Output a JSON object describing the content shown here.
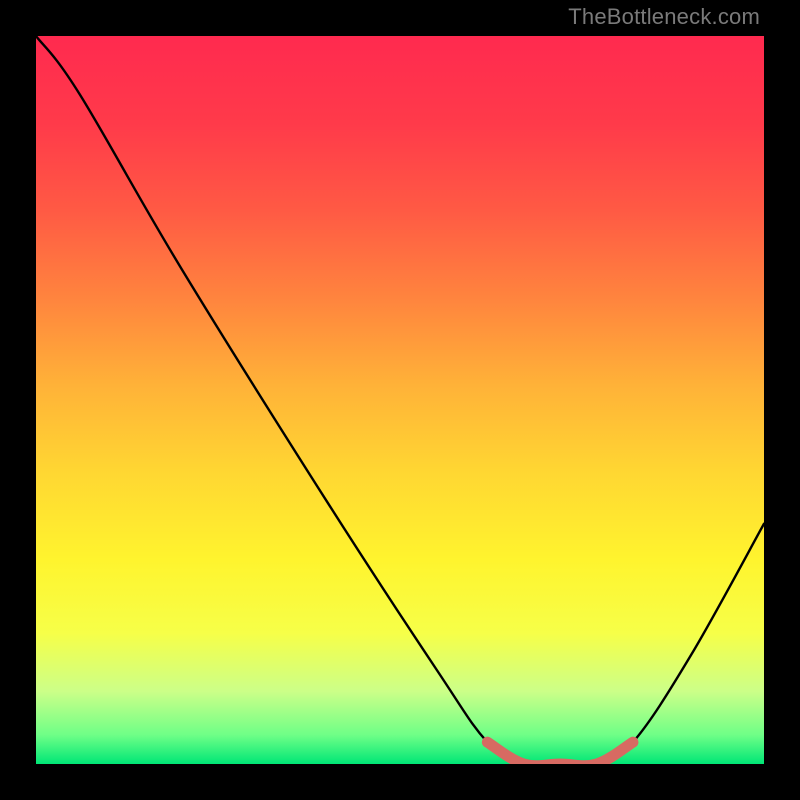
{
  "watermark": "TheBottleneck.com",
  "chart_data": {
    "type": "line",
    "title": "",
    "xlabel": "",
    "ylabel": "",
    "xlim": [
      0,
      100
    ],
    "ylim": [
      0,
      100
    ],
    "series": [
      {
        "name": "curve",
        "x": [
          0,
          6,
          20,
          40,
          55,
          62,
          67,
          72,
          77,
          82,
          90,
          100
        ],
        "values": [
          100,
          92,
          68,
          36,
          13,
          3,
          0,
          0,
          0,
          3,
          15,
          33
        ]
      }
    ],
    "highlight": {
      "name": "min-band",
      "color": "#d76a62",
      "x_start": 62,
      "x_end": 82
    },
    "gradient_stops": [
      {
        "pct": 0,
        "color": "#ff2a4f"
      },
      {
        "pct": 50,
        "color": "#ffd732"
      },
      {
        "pct": 85,
        "color": "#fff42e"
      },
      {
        "pct": 100,
        "color": "#00e676"
      }
    ]
  }
}
